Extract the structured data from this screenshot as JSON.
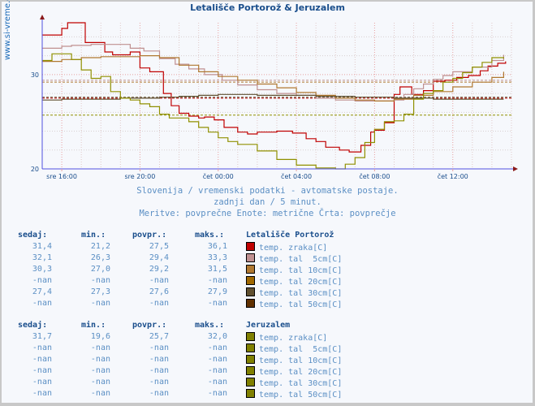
{
  "title": "Letališče Portorož & Jeruzalem",
  "side_label": "www.si-vreme.com",
  "captions": [
    "Slovenija / vremenski podatki - avtomatske postaje.",
    "zadnji dan / 5 minut.",
    "Meritve: povprečne  Enote: metrične  Črta: povprečje"
  ],
  "chart_data": {
    "type": "line",
    "title": "Letališče Portorož & Jeruzalem",
    "xlabel": "",
    "ylabel": "",
    "x_unit": "hours since sre 15:00",
    "xlim": [
      0,
      24
    ],
    "ylim": [
      20,
      35.5
    ],
    "ytick_labels": [
      {
        "value": 20,
        "label": "20"
      },
      {
        "value": 30,
        "label": "30"
      }
    ],
    "xtick_labels": [
      {
        "value": 1,
        "label": "sre 16:00"
      },
      {
        "value": 5,
        "label": "sre 20:00"
      },
      {
        "value": 9,
        "label": "čet 00:00"
      },
      {
        "value": 13,
        "label": "čet 04:00"
      },
      {
        "value": 17,
        "label": "čet 08:00"
      },
      {
        "value": 21,
        "label": "čet 12:00"
      }
    ],
    "grid": true,
    "series": [
      {
        "name": "Letališče Portorož temp. zraka[C]",
        "color": "#c00000",
        "avg": 27.5,
        "x": [
          0,
          0.6,
          1.0,
          1.3,
          2.0,
          2.2,
          2.8,
          3.2,
          3.6,
          4.0,
          4.5,
          5.0,
          5.5,
          6.2,
          6.6,
          7.0,
          7.5,
          8.0,
          8.3,
          8.8,
          9.3,
          10.0,
          10.5,
          11.0,
          12.0,
          12.8,
          13.5,
          14.0,
          14.5,
          15.2,
          15.7,
          16.3,
          16.8,
          17.0,
          17.5,
          18.0,
          18.3,
          18.9,
          19.5,
          20.0,
          20.6,
          21.2,
          21.8,
          22.4,
          22.8,
          23.3,
          23.7
        ],
        "y": [
          34.2,
          34.2,
          34.9,
          35.5,
          35.5,
          33.4,
          33.4,
          32.4,
          32.1,
          32.1,
          32.4,
          30.7,
          30.3,
          28.0,
          26.7,
          25.9,
          25.6,
          25.4,
          25.5,
          25.2,
          24.4,
          23.9,
          23.7,
          23.9,
          24.0,
          23.8,
          23.2,
          22.9,
          22.3,
          22.0,
          21.8,
          22.5,
          23.9,
          24.1,
          24.9,
          27.9,
          28.7,
          27.9,
          28.3,
          29.3,
          29.4,
          29.7,
          29.9,
          30.4,
          30.9,
          31.2,
          31.4
        ]
      },
      {
        "name": "Letališče Portorož temp. tal  5cm[C]",
        "color": "#c09090",
        "avg": 29.4,
        "x": [
          0,
          1.0,
          1.5,
          2.5,
          3.5,
          4.5,
          5.2,
          6.0,
          6.8,
          7.5,
          8.3,
          9.2,
          10.0,
          11.0,
          12.0,
          13.0,
          14.0,
          15.0,
          16.0,
          17.0,
          18.0,
          18.5,
          19.0,
          19.5,
          20.0,
          20.5,
          21.0,
          22.0,
          23.0,
          23.6
        ],
        "y": [
          32.8,
          33.0,
          33.1,
          33.2,
          33.2,
          32.8,
          32.5,
          31.7,
          31.1,
          30.6,
          30.0,
          29.4,
          28.9,
          28.4,
          28.0,
          27.8,
          27.5,
          27.3,
          27.2,
          27.2,
          27.3,
          27.9,
          28.5,
          29.0,
          29.5,
          29.9,
          30.3,
          30.8,
          31.5,
          32.1
        ]
      },
      {
        "name": "Letališče Portorož temp. tal 10cm[C]",
        "color": "#b07830",
        "avg": 29.2,
        "x": [
          0,
          1.0,
          2.0,
          3.0,
          4.0,
          5.0,
          6.0,
          7.0,
          8.0,
          9.0,
          10.0,
          11.0,
          12.0,
          13.0,
          14.0,
          15.0,
          16.0,
          17.0,
          18.0,
          19.0,
          20.0,
          21.0,
          22.0,
          23.0,
          23.6
        ],
        "y": [
          31.4,
          31.6,
          31.8,
          31.9,
          31.9,
          32.0,
          31.8,
          31.0,
          30.3,
          29.8,
          29.4,
          29.0,
          28.6,
          28.1,
          27.8,
          27.5,
          27.3,
          27.2,
          27.4,
          27.8,
          28.2,
          28.7,
          29.2,
          29.7,
          30.3
        ]
      },
      {
        "name": "Letališče Portorož temp. tal 30cm[C]",
        "color": "#605030",
        "avg": 27.6,
        "x": [
          0,
          1.0,
          2.0,
          3.0,
          4.0,
          5.0,
          6.0,
          7.0,
          8.0,
          9.0,
          10.0,
          11.0,
          12.0,
          13.0,
          14.0,
          15.0,
          16.0,
          17.0,
          18.0,
          19.0,
          20.0,
          21.0,
          22.0,
          23.0,
          23.6
        ],
        "y": [
          27.3,
          27.4,
          27.4,
          27.4,
          27.5,
          27.5,
          27.6,
          27.7,
          27.8,
          27.9,
          27.9,
          27.8,
          27.8,
          27.8,
          27.7,
          27.7,
          27.6,
          27.6,
          27.5,
          27.5,
          27.4,
          27.4,
          27.4,
          27.4,
          27.4
        ]
      },
      {
        "name": "Jeruzalem temp. zraka[C]",
        "color": "#909000",
        "avg": 25.7,
        "x": [
          0,
          0.5,
          1.0,
          1.5,
          2.0,
          2.5,
          3.0,
          3.5,
          4.0,
          4.5,
          5.0,
          5.5,
          6.0,
          6.5,
          7.0,
          7.5,
          8.0,
          8.5,
          9.0,
          9.5,
          10.0,
          11.0,
          12.0,
          13.0,
          14.0,
          15.0,
          15.5,
          16.0,
          16.5,
          17.0,
          17.5,
          18.0,
          18.5,
          19.0,
          19.5,
          20.0,
          20.5,
          21.0,
          21.5,
          22.0,
          22.5,
          23.0,
          23.6
        ],
        "y": [
          31.5,
          32.2,
          32.2,
          31.6,
          30.5,
          29.6,
          29.8,
          28.2,
          27.5,
          27.3,
          26.9,
          26.6,
          25.8,
          25.4,
          25.4,
          25.0,
          24.4,
          23.9,
          23.3,
          22.9,
          22.6,
          21.9,
          21.0,
          20.4,
          20.1,
          20.0,
          20.5,
          21.2,
          22.8,
          24.2,
          25.0,
          25.1,
          25.8,
          27.4,
          28.0,
          28.3,
          29.2,
          29.6,
          30.2,
          30.8,
          31.3,
          31.8,
          31.7
        ]
      }
    ],
    "avg_lines": [
      {
        "series": "Letališče Portorož temp. zraka[C]",
        "value": 27.5,
        "color": "#c00000"
      },
      {
        "series": "Letališče Portorož temp. tal  5cm[C]",
        "value": 29.4,
        "color": "#c09090"
      },
      {
        "series": "Letališče Portorož temp. tal 10cm[C]",
        "value": 29.2,
        "color": "#b07830"
      },
      {
        "series": "Letališče Portorož temp. tal 30cm[C]",
        "value": 27.6,
        "color": "#605030"
      },
      {
        "series": "Jeruzalem temp. zraka[C]",
        "value": 25.7,
        "color": "#909000"
      }
    ]
  },
  "stations": [
    {
      "name": "Letališče Portorož",
      "headers": [
        "sedaj:",
        "min.:",
        "povpr.:",
        "maks.:"
      ],
      "rows": [
        {
          "now": "31,4",
          "min": "21,2",
          "avg": "27,5",
          "max": "36,1",
          "color": "#c00000",
          "label": "temp. zraka[C]"
        },
        {
          "now": "32,1",
          "min": "26,3",
          "avg": "29,4",
          "max": "33,3",
          "color": "#c09090",
          "label": "temp. tal  5cm[C]"
        },
        {
          "now": "30,3",
          "min": "27,0",
          "avg": "29,2",
          "max": "31,5",
          "color": "#b07830",
          "label": "temp. tal 10cm[C]"
        },
        {
          "now": "-nan",
          "min": "-nan",
          "avg": "-nan",
          "max": "-nan",
          "color": "#a06800",
          "label": "temp. tal 20cm[C]"
        },
        {
          "now": "27,4",
          "min": "27,3",
          "avg": "27,6",
          "max": "27,9",
          "color": "#605030",
          "label": "temp. tal 30cm[C]"
        },
        {
          "now": "-nan",
          "min": "-nan",
          "avg": "-nan",
          "max": "-nan",
          "color": "#603000",
          "label": "temp. tal 50cm[C]"
        }
      ]
    },
    {
      "name": "Jeruzalem",
      "headers": [
        "sedaj:",
        "min.:",
        "povpr.:",
        "maks.:"
      ],
      "rows": [
        {
          "now": "31,7",
          "min": "19,6",
          "avg": "25,7",
          "max": "32,0",
          "color": "#808000",
          "label": "temp. zraka[C]"
        },
        {
          "now": "-nan",
          "min": "-nan",
          "avg": "-nan",
          "max": "-nan",
          "color": "#808000",
          "label": "temp. tal  5cm[C]"
        },
        {
          "now": "-nan",
          "min": "-nan",
          "avg": "-nan",
          "max": "-nan",
          "color": "#808000",
          "label": "temp. tal 10cm[C]"
        },
        {
          "now": "-nan",
          "min": "-nan",
          "avg": "-nan",
          "max": "-nan",
          "color": "#808000",
          "label": "temp. tal 20cm[C]"
        },
        {
          "now": "-nan",
          "min": "-nan",
          "avg": "-nan",
          "max": "-nan",
          "color": "#808000",
          "label": "temp. tal 30cm[C]"
        },
        {
          "now": "-nan",
          "min": "-nan",
          "avg": "-nan",
          "max": "-nan",
          "color": "#808000",
          "label": "temp. tal 50cm[C]"
        }
      ]
    }
  ]
}
